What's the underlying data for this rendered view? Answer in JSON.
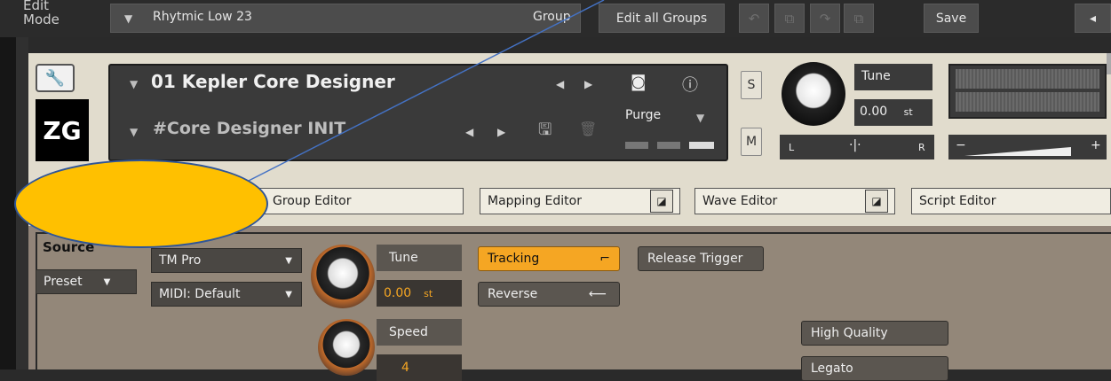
{
  "topbar": {
    "edit_mode": "Edit\nMode",
    "group_name": "Rhytmic Low 23",
    "group_label": "Group",
    "edit_all_groups": "Edit all Groups",
    "save": "Save"
  },
  "instrument": {
    "logo": "ZG",
    "name": "01 Kepler Core Designer",
    "preset": "#Core Designer INIT",
    "purge": "Purge",
    "solo": "S",
    "mute": "M",
    "tune_label": "Tune",
    "tune_value": "0.00",
    "tune_unit": "st",
    "pan_left": "L",
    "pan_right": "R",
    "vol_minus": "−",
    "vol_plus": "+"
  },
  "editors": {
    "group_editor": "Group Editor",
    "mapping_editor": "Mapping Editor",
    "wave_editor": "Wave Editor",
    "script_editor": "Script Editor"
  },
  "source": {
    "title": "Source",
    "preset": "Preset",
    "mode": "TM Pro",
    "midi": "MIDI: Default",
    "tune_label": "Tune",
    "tune_value": "0.00",
    "tune_unit": "st",
    "speed_label": "Speed",
    "speed_value": "4",
    "tracking": "Tracking",
    "reverse": "Reverse",
    "release_trigger": "Release Trigger",
    "high_quality": "High Quality",
    "legato": "Legato"
  },
  "colors": {
    "accent_orange": "#f5a623",
    "callout_fill": "#ffc000",
    "callout_line": "#4472c4"
  }
}
